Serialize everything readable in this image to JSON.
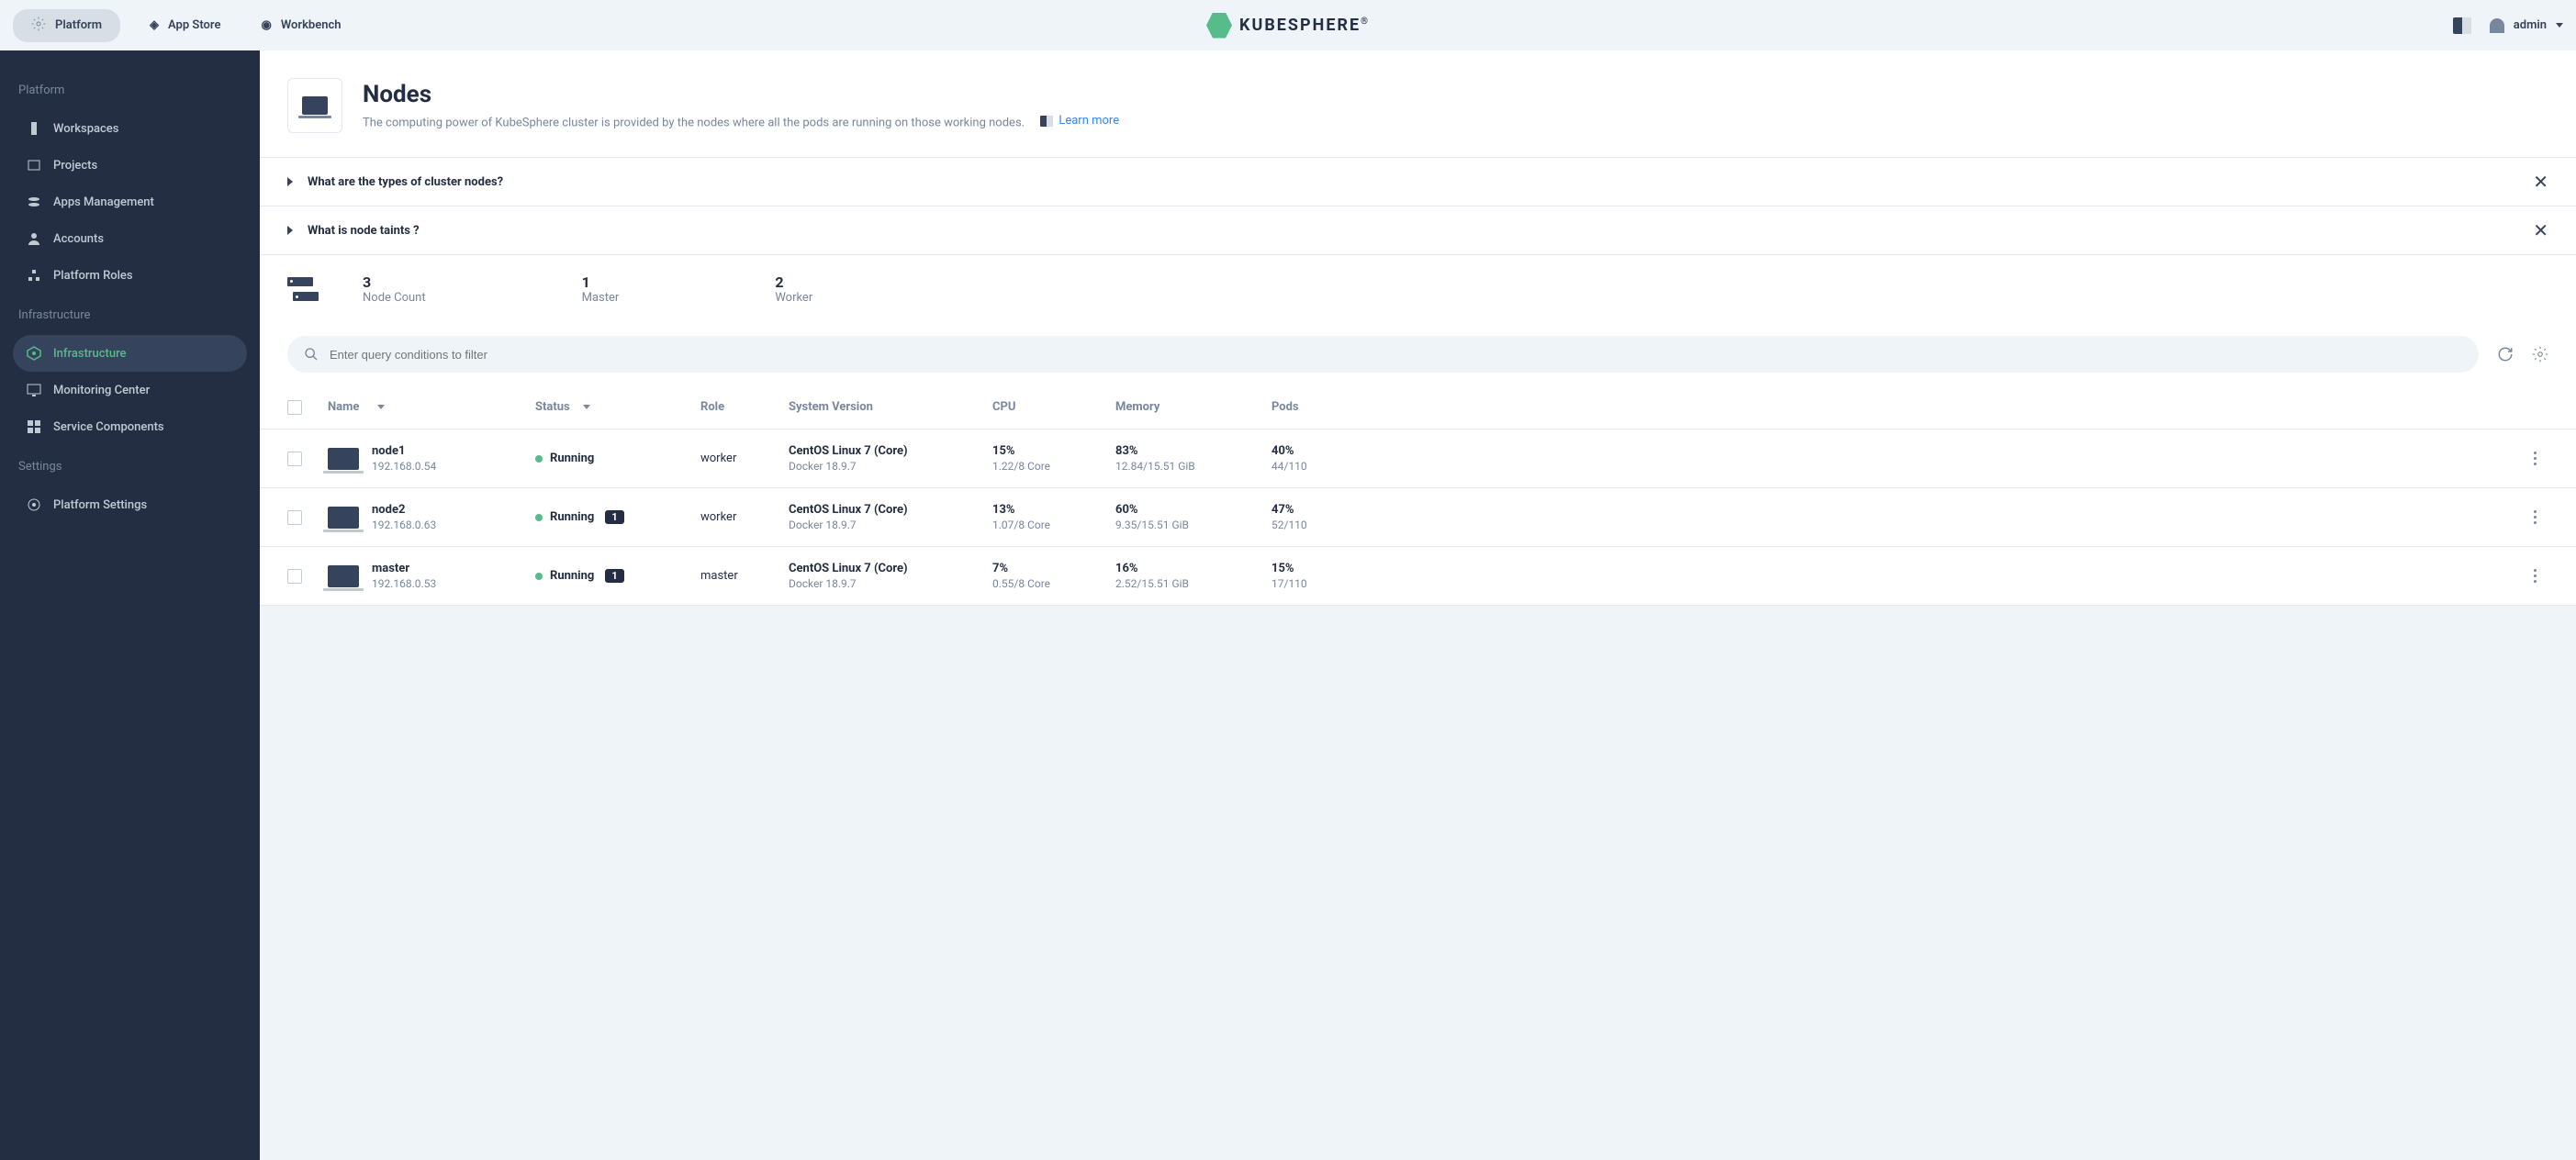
{
  "topbar": {
    "platform": "Platform",
    "app_store": "App Store",
    "workbench": "Workbench",
    "logo_text": "KUBESPHERE",
    "user": "admin"
  },
  "sidebar": {
    "sections": [
      {
        "title": "Platform",
        "items": [
          {
            "label": "Workspaces",
            "icon": "workspaces"
          },
          {
            "label": "Projects",
            "icon": "projects"
          },
          {
            "label": "Apps Management",
            "icon": "apps"
          },
          {
            "label": "Accounts",
            "icon": "accounts"
          },
          {
            "label": "Platform Roles",
            "icon": "roles"
          }
        ]
      },
      {
        "title": "Infrastructure",
        "items": [
          {
            "label": "Infrastructure",
            "icon": "infra",
            "active": true
          },
          {
            "label": "Monitoring Center",
            "icon": "monitor"
          },
          {
            "label": "Service Components",
            "icon": "components"
          }
        ]
      },
      {
        "title": "Settings",
        "items": [
          {
            "label": "Platform Settings",
            "icon": "settings"
          }
        ]
      }
    ]
  },
  "page": {
    "title": "Nodes",
    "description": "The computing power of KubeSphere cluster is provided by the nodes where all the pods are running on those working nodes.",
    "learn_more": "Learn more"
  },
  "faq": [
    {
      "text": "What are the types of cluster nodes?"
    },
    {
      "text": "What is node taints ?"
    }
  ],
  "stats": [
    {
      "value": "3",
      "label": "Node Count"
    },
    {
      "value": "1",
      "label": "Master"
    },
    {
      "value": "2",
      "label": "Worker"
    }
  ],
  "search": {
    "placeholder": "Enter query conditions to filter"
  },
  "table": {
    "headers": {
      "name": "Name",
      "status": "Status",
      "role": "Role",
      "system": "System Version",
      "cpu": "CPU",
      "memory": "Memory",
      "pods": "Pods"
    },
    "rows": [
      {
        "name": "node1",
        "ip": "192.168.0.54",
        "status": "Running",
        "badge": null,
        "role": "worker",
        "os": "CentOS Linux 7 (Core)",
        "docker": "Docker 18.9.7",
        "cpu_pct": "15%",
        "cpu_sub": "1.22/8 Core",
        "mem_pct": "83%",
        "mem_sub": "12.84/15.51 GiB",
        "pods_pct": "40%",
        "pods_sub": "44/110"
      },
      {
        "name": "node2",
        "ip": "192.168.0.63",
        "status": "Running",
        "badge": "1",
        "role": "worker",
        "os": "CentOS Linux 7 (Core)",
        "docker": "Docker 18.9.7",
        "cpu_pct": "13%",
        "cpu_sub": "1.07/8 Core",
        "mem_pct": "60%",
        "mem_sub": "9.35/15.51 GiB",
        "pods_pct": "47%",
        "pods_sub": "52/110"
      },
      {
        "name": "master",
        "ip": "192.168.0.53",
        "status": "Running",
        "badge": "1",
        "role": "master",
        "os": "CentOS Linux 7 (Core)",
        "docker": "Docker 18.9.7",
        "cpu_pct": "7%",
        "cpu_sub": "0.55/8 Core",
        "mem_pct": "16%",
        "mem_sub": "2.52/15.51 GiB",
        "pods_pct": "15%",
        "pods_sub": "17/110"
      }
    ]
  }
}
